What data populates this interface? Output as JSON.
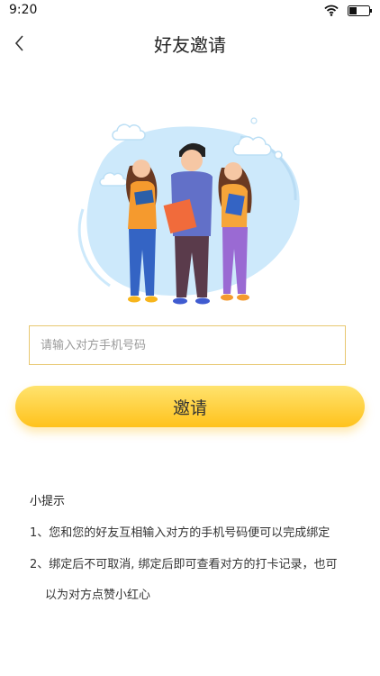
{
  "status": {
    "time": "9:20"
  },
  "header": {
    "title": "好友邀请"
  },
  "form": {
    "phone_placeholder": "请输入对方手机号码",
    "phone_value": "",
    "submit_label": "邀请"
  },
  "tips": {
    "title": "小提示",
    "items": [
      "1、您和您的好友互相输入对方的手机号码便可以完成绑定",
      "2、绑定后不可取消, 绑定后即可查看对方的打卡记录，也可",
      "以为对方点赞小红心"
    ]
  },
  "colors": {
    "accent": "#ffc21c",
    "input_border": "#e8c770"
  },
  "icons": [
    "wifi-icon",
    "battery-icon",
    "back-arrow-icon"
  ]
}
